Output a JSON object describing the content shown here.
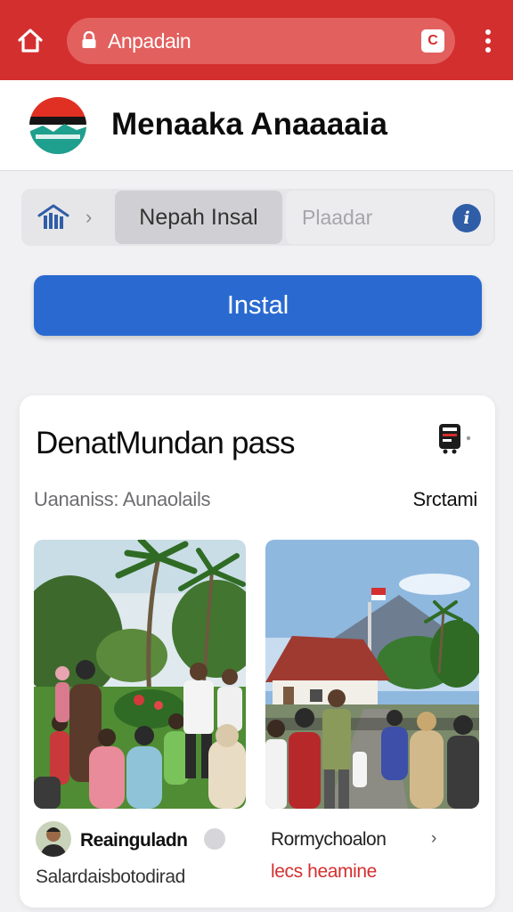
{
  "browser": {
    "url": "Anpadain",
    "tab_count": "C"
  },
  "app": {
    "title": "Menaaka Anaaaaia"
  },
  "breadcrumb": {
    "separator": "›",
    "active_tab": "Nepah Insal",
    "second_tab": "Plaadar",
    "info_symbol": "i"
  },
  "install": {
    "label": "Instal"
  },
  "card": {
    "title": "DenatMundan pass",
    "subtitle": "Uananiss: Aunaolails",
    "action": "Srctami",
    "posts": [
      {
        "title": "Reainguladn",
        "subtitle": "Salardaisbotodirad"
      },
      {
        "title": "Rormychoalon",
        "chevron": "›",
        "subtitle": "lecs heamine"
      }
    ]
  },
  "colors": {
    "topbar": "#d32f2f",
    "primary_button": "#2a6ad0",
    "info_icon": "#2f5ea7",
    "accent_text": "#d32f2f"
  },
  "icons": [
    "home-icon",
    "lock-icon",
    "menu-dots-icon",
    "app-logo",
    "breadcrumb-home-icon",
    "info-icon",
    "card-media-icon",
    "share-icon"
  ]
}
